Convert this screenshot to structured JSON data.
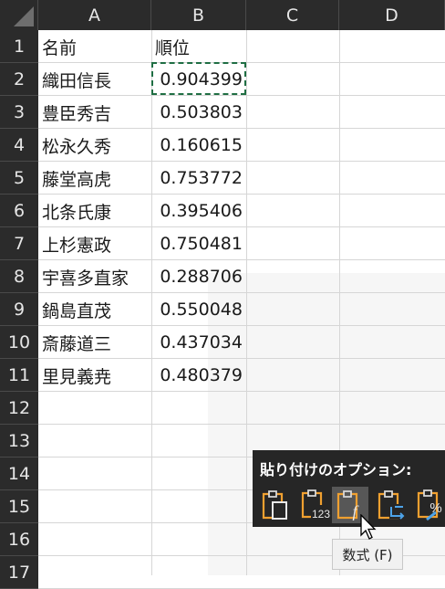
{
  "columns": [
    "A",
    "B",
    "C",
    "D"
  ],
  "rows": [
    "1",
    "2",
    "3",
    "4",
    "5",
    "6",
    "7",
    "8",
    "9",
    "10",
    "11",
    "12",
    "13",
    "14",
    "15",
    "16",
    "17"
  ],
  "cells": [
    {
      "a": "名前",
      "b": "順位"
    },
    {
      "a": "織田信長",
      "b": "0.904399"
    },
    {
      "a": "豊臣秀吉",
      "b": "0.503803"
    },
    {
      "a": "松永久秀",
      "b": "0.160615"
    },
    {
      "a": "藤堂高虎",
      "b": "0.753772"
    },
    {
      "a": "北条氏康",
      "b": "0.395406"
    },
    {
      "a": "上杉憲政",
      "b": "0.750481"
    },
    {
      "a": "宇喜多直家",
      "b": "0.288706"
    },
    {
      "a": "鍋島直茂",
      "b": "0.550048"
    },
    {
      "a": "斎藤道三",
      "b": "0.437034"
    },
    {
      "a": "里見義尭",
      "b": "0.480379"
    }
  ],
  "paste_options": {
    "title": "貼り付けのオプション:",
    "buttons": [
      {
        "icon": "paste-icon"
      },
      {
        "icon": "paste-values-icon",
        "badge": "123"
      },
      {
        "icon": "paste-formulas-icon",
        "badge": "fx"
      },
      {
        "icon": "paste-transpose-icon"
      },
      {
        "icon": "paste-formatting-icon"
      }
    ],
    "tooltip": "数式 (F)"
  },
  "colors": {
    "header_bg": "#2b2b2b",
    "selection_border": "#1f6e43",
    "clipboard_orange": "#f0a030",
    "panel_bg": "#262626"
  }
}
